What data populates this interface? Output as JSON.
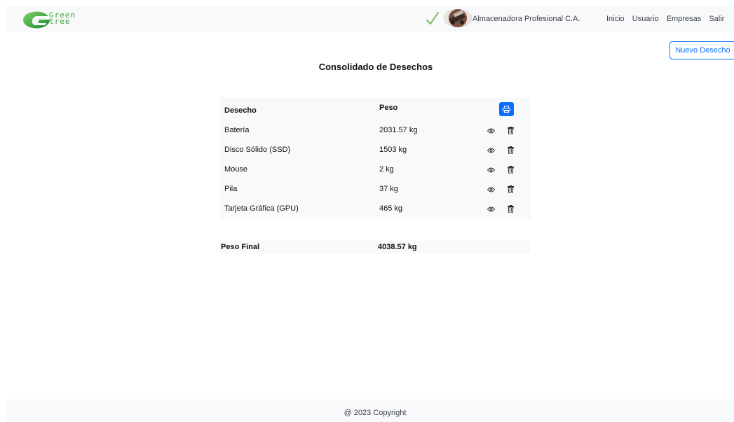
{
  "brand": {
    "logo_text": "Green\ntree",
    "logo_color": "#3aa63a"
  },
  "header": {
    "company_name": "Almacenadora Profesional C.A.",
    "nav": [
      "Inicio",
      "Usuario",
      "Empresas",
      "Salir"
    ]
  },
  "actions": {
    "new_label": "Nuevo Desecho"
  },
  "page": {
    "title": "Consolidado de Desechos"
  },
  "table": {
    "columns": [
      "Desecho",
      "Peso"
    ],
    "rows": [
      {
        "desecho": "Batería",
        "peso": "2031.57 kg"
      },
      {
        "desecho": "Disco Sólido (SSD)",
        "peso": "1503 kg"
      },
      {
        "desecho": "Mouse",
        "peso": "2 kg"
      },
      {
        "desecho": "Pila",
        "peso": "37 kg"
      },
      {
        "desecho": "Tarjeta Gráfica (GPU)",
        "peso": "465 kg"
      }
    ],
    "print_icon": "print-icon",
    "view_icon": "eye-icon",
    "delete_icon": "trash-icon"
  },
  "total": {
    "label": "Peso Final",
    "value": "4038.57 kg"
  },
  "footer": {
    "text": "@ 2023 Copyright"
  },
  "colors": {
    "primary": "#0d6efd",
    "surface": "#f8f9fa",
    "brand_green": "#3aa63a"
  }
}
